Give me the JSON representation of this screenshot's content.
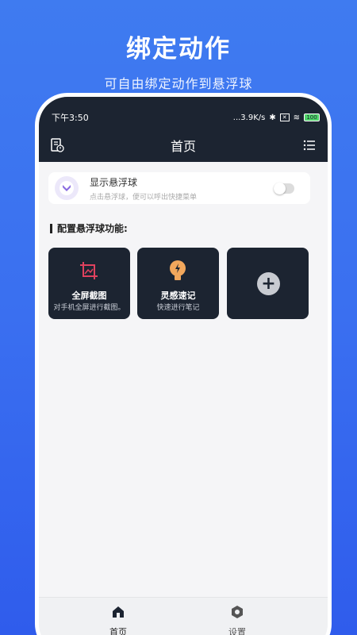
{
  "promo": {
    "title": "绑定动作",
    "subtitle": "可自由绑定动作到悬浮球"
  },
  "status_bar": {
    "time": "下午3:50",
    "speed": "...3.9K/s",
    "battery": "100"
  },
  "nav": {
    "title": "首页",
    "left_icon": "history-icon",
    "right_icon": "list-menu-icon"
  },
  "float_ball": {
    "title": "显示悬浮球",
    "description": "点击悬浮球，便可以呼出快捷菜单",
    "toggle_on": false
  },
  "section": {
    "label": "配置悬浮球功能:"
  },
  "tiles": [
    {
      "title": "全屏截图",
      "description": "对手机全屏进行截图。",
      "icon": "screenshot-icon"
    },
    {
      "title": "灵感速记",
      "description": "快速进行笔记",
      "icon": "bulb-icon"
    },
    {
      "title": "",
      "description": "",
      "icon": "add-icon"
    }
  ],
  "tabbar": {
    "items": [
      {
        "label": "首页",
        "icon": "home-icon",
        "active": true
      },
      {
        "label": "设置",
        "icon": "settings-icon",
        "active": false
      }
    ]
  },
  "colors": {
    "background": "#3a6ff0",
    "header": "#1c2431",
    "accent_red": "#e0415e",
    "accent_orange": "#f2a75c",
    "float_icon": "#8a6be0"
  }
}
